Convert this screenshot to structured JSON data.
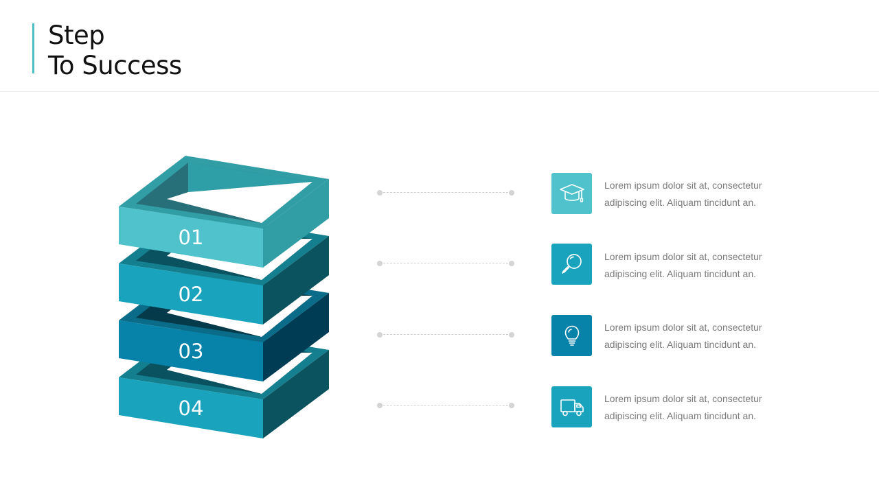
{
  "slide": {
    "title_line1": "Step",
    "title_line2": "To Success",
    "accent_color": "#4fbfc9"
  },
  "steps": [
    {
      "number": "01",
      "icon": "graduation-cap-icon",
      "color": "#4fc2cc",
      "text_line1": "Lorem ipsum dolor sit at, consectetur",
      "text_line2": "adipiscing elit. Aliquam tincidunt an."
    },
    {
      "number": "02",
      "icon": "magnifier-icon",
      "color": "#1aa3bd",
      "text_line1": "Lorem ipsum dolor sit at, consectetur",
      "text_line2": "adipiscing elit. Aliquam tincidunt an."
    },
    {
      "number": "03",
      "icon": "lightbulb-icon",
      "color": "#0783a9",
      "text_line1": "Lorem ipsum dolor sit at, consectetur",
      "text_line2": "adipiscing elit. Aliquam tincidunt an."
    },
    {
      "number": "04",
      "icon": "delivery-truck-icon",
      "color": "#1aa3bd",
      "text_line1": "Lorem ipsum dolor sit at, consectetur",
      "text_line2": "adipiscing elit. Aliquam tincidunt an."
    }
  ]
}
